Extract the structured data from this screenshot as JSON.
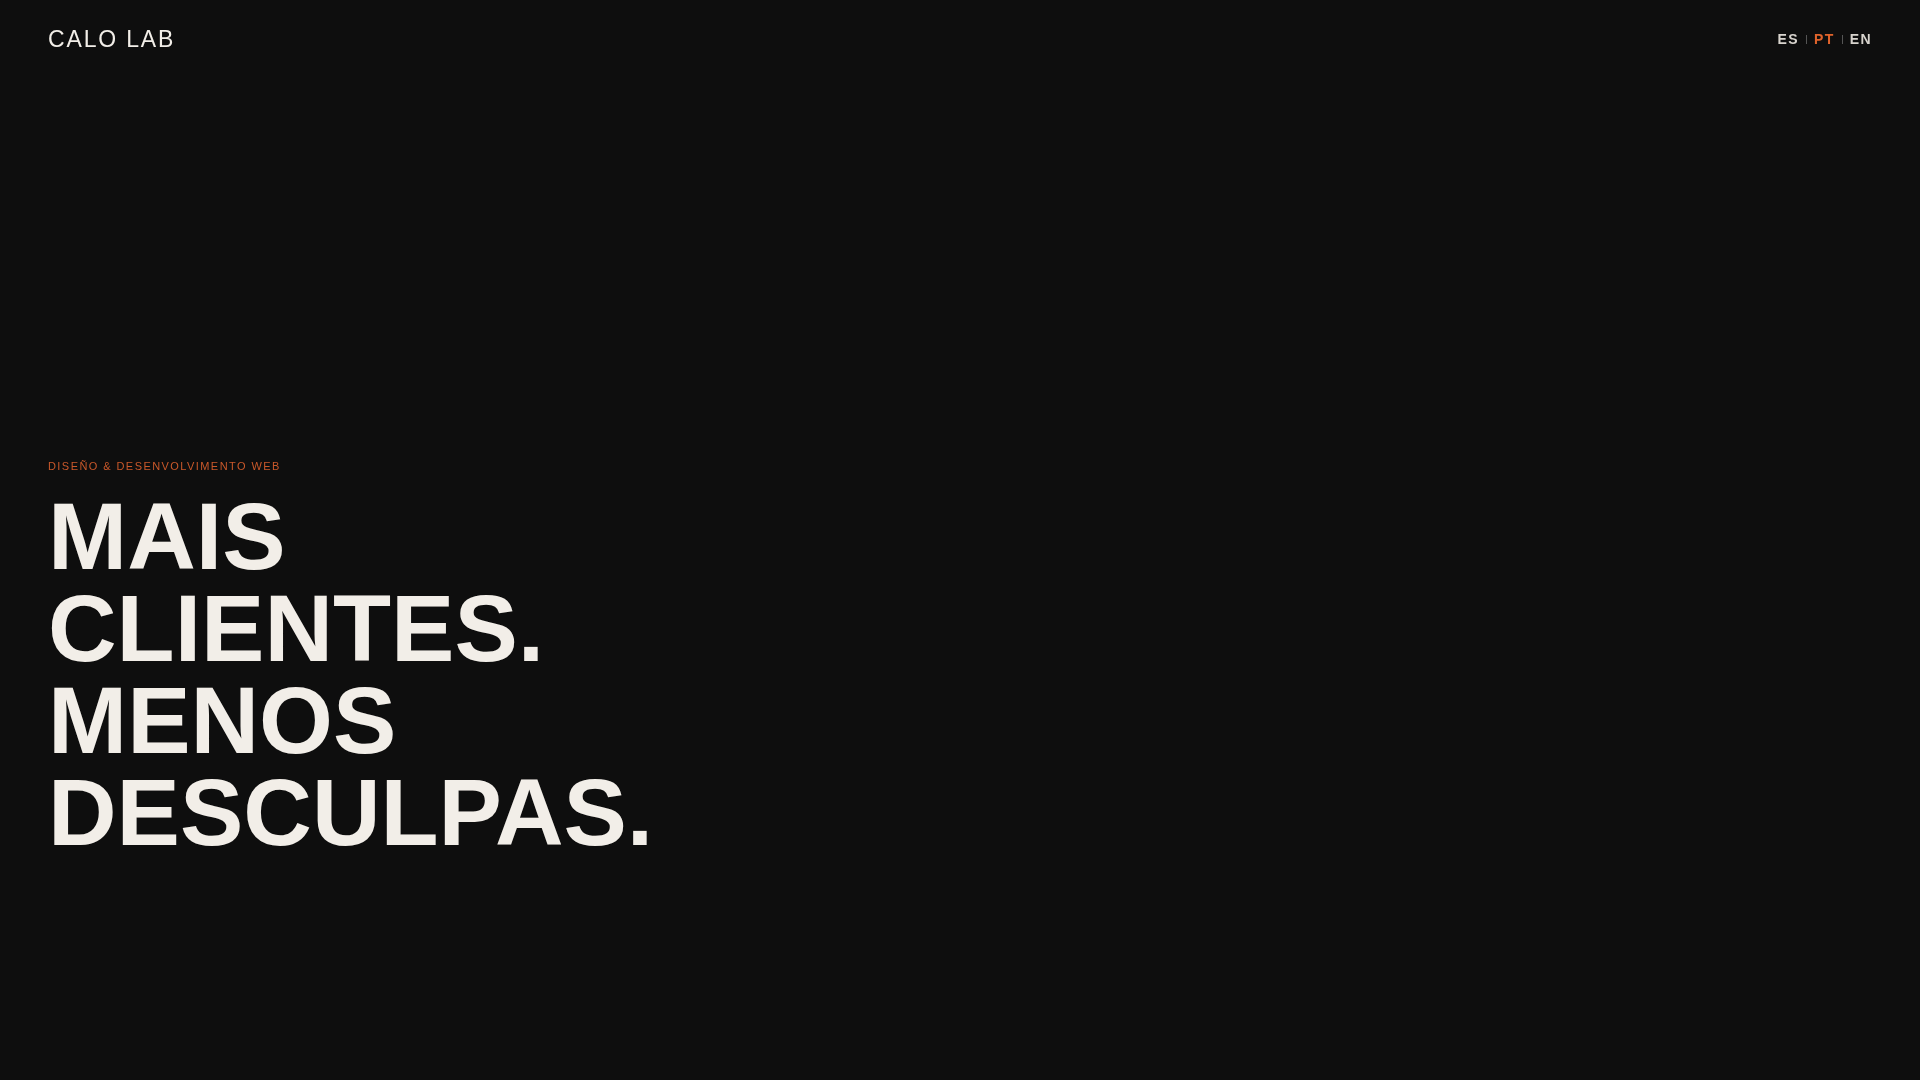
{
  "header": {
    "logo": "CALO LAB",
    "languages": [
      {
        "label": "ES",
        "selected": false
      },
      {
        "label": "PT",
        "selected": true
      },
      {
        "label": "EN",
        "selected": false
      }
    ]
  },
  "hero": {
    "eyebrow": "DISEÑO & DESENVOLVIMENTO WEB",
    "headline": [
      "MAIS",
      "CLIENTES.",
      "MENOS",
      "DESCULPAS."
    ]
  }
}
